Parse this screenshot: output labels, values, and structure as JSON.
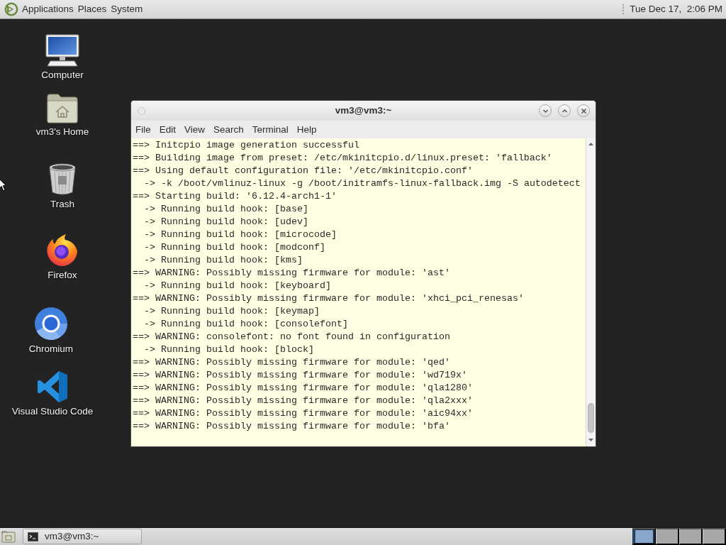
{
  "top_panel": {
    "menus": [
      "Applications",
      "Places",
      "System"
    ],
    "clock": "Tue Dec 17,  2:06 PM"
  },
  "desktop_icons": [
    {
      "kind": "computer",
      "label": "Computer"
    },
    {
      "kind": "home",
      "label": "vm3's Home"
    },
    {
      "kind": "trash",
      "label": "Trash"
    },
    {
      "kind": "firefox",
      "label": "Firefox"
    },
    {
      "kind": "chromium",
      "label": "Chromium"
    },
    {
      "kind": "vscode",
      "label": "Visual Studio Code"
    }
  ],
  "terminal": {
    "title": "vm3@vm3:~",
    "menus": [
      "File",
      "Edit",
      "View",
      "Search",
      "Terminal",
      "Help"
    ],
    "lines": [
      {
        "kind": "main",
        "text": "==> Initcpio image generation successful"
      },
      {
        "kind": "main",
        "text": "==> Building image from preset: /etc/mkinitcpio.d/linux.preset: 'fallback'"
      },
      {
        "kind": "main",
        "text": "==> Using default configuration file: '/etc/mkinitcpio.conf'"
      },
      {
        "kind": "sub",
        "text": "-> -k /boot/vmlinuz-linux -g /boot/initramfs-linux-fallback.img -S autodetect"
      },
      {
        "kind": "main",
        "text": "==> Starting build: '6.12.4-arch1-1'"
      },
      {
        "kind": "sub",
        "text": "-> Running build hook: [base]"
      },
      {
        "kind": "sub",
        "text": "-> Running build hook: [udev]"
      },
      {
        "kind": "sub",
        "text": "-> Running build hook: [microcode]"
      },
      {
        "kind": "sub",
        "text": "-> Running build hook: [modconf]"
      },
      {
        "kind": "sub",
        "text": "-> Running build hook: [kms]"
      },
      {
        "kind": "main",
        "text": "==> WARNING: Possibly missing firmware for module: 'ast'"
      },
      {
        "kind": "sub",
        "text": "-> Running build hook: [keyboard]"
      },
      {
        "kind": "main",
        "text": "==> WARNING: Possibly missing firmware for module: 'xhci_pci_renesas'"
      },
      {
        "kind": "sub",
        "text": "-> Running build hook: [keymap]"
      },
      {
        "kind": "sub",
        "text": "-> Running build hook: [consolefont]"
      },
      {
        "kind": "main",
        "text": "==> WARNING: consolefont: no font found in configuration"
      },
      {
        "kind": "sub",
        "text": "-> Running build hook: [block]"
      },
      {
        "kind": "main",
        "text": "==> WARNING: Possibly missing firmware for module: 'qed'"
      },
      {
        "kind": "main",
        "text": "==> WARNING: Possibly missing firmware for module: 'wd719x'"
      },
      {
        "kind": "main",
        "text": "==> WARNING: Possibly missing firmware for module: 'qla1280'"
      },
      {
        "kind": "main",
        "text": "==> WARNING: Possibly missing firmware for module: 'qla2xxx'"
      },
      {
        "kind": "main",
        "text": "==> WARNING: Possibly missing firmware for module: 'aic94xx'"
      },
      {
        "kind": "main",
        "text": "==> WARNING: Possibly missing firmware for module: 'bfa'"
      }
    ]
  },
  "taskbar": {
    "tasks": [
      {
        "label": "vm3@vm3:~"
      }
    ],
    "workspaces": [
      {
        "selected": true,
        "has_window": true
      },
      {
        "selected": false,
        "has_window": false
      },
      {
        "selected": false,
        "has_window": false
      },
      {
        "selected": false,
        "has_window": false
      }
    ]
  }
}
